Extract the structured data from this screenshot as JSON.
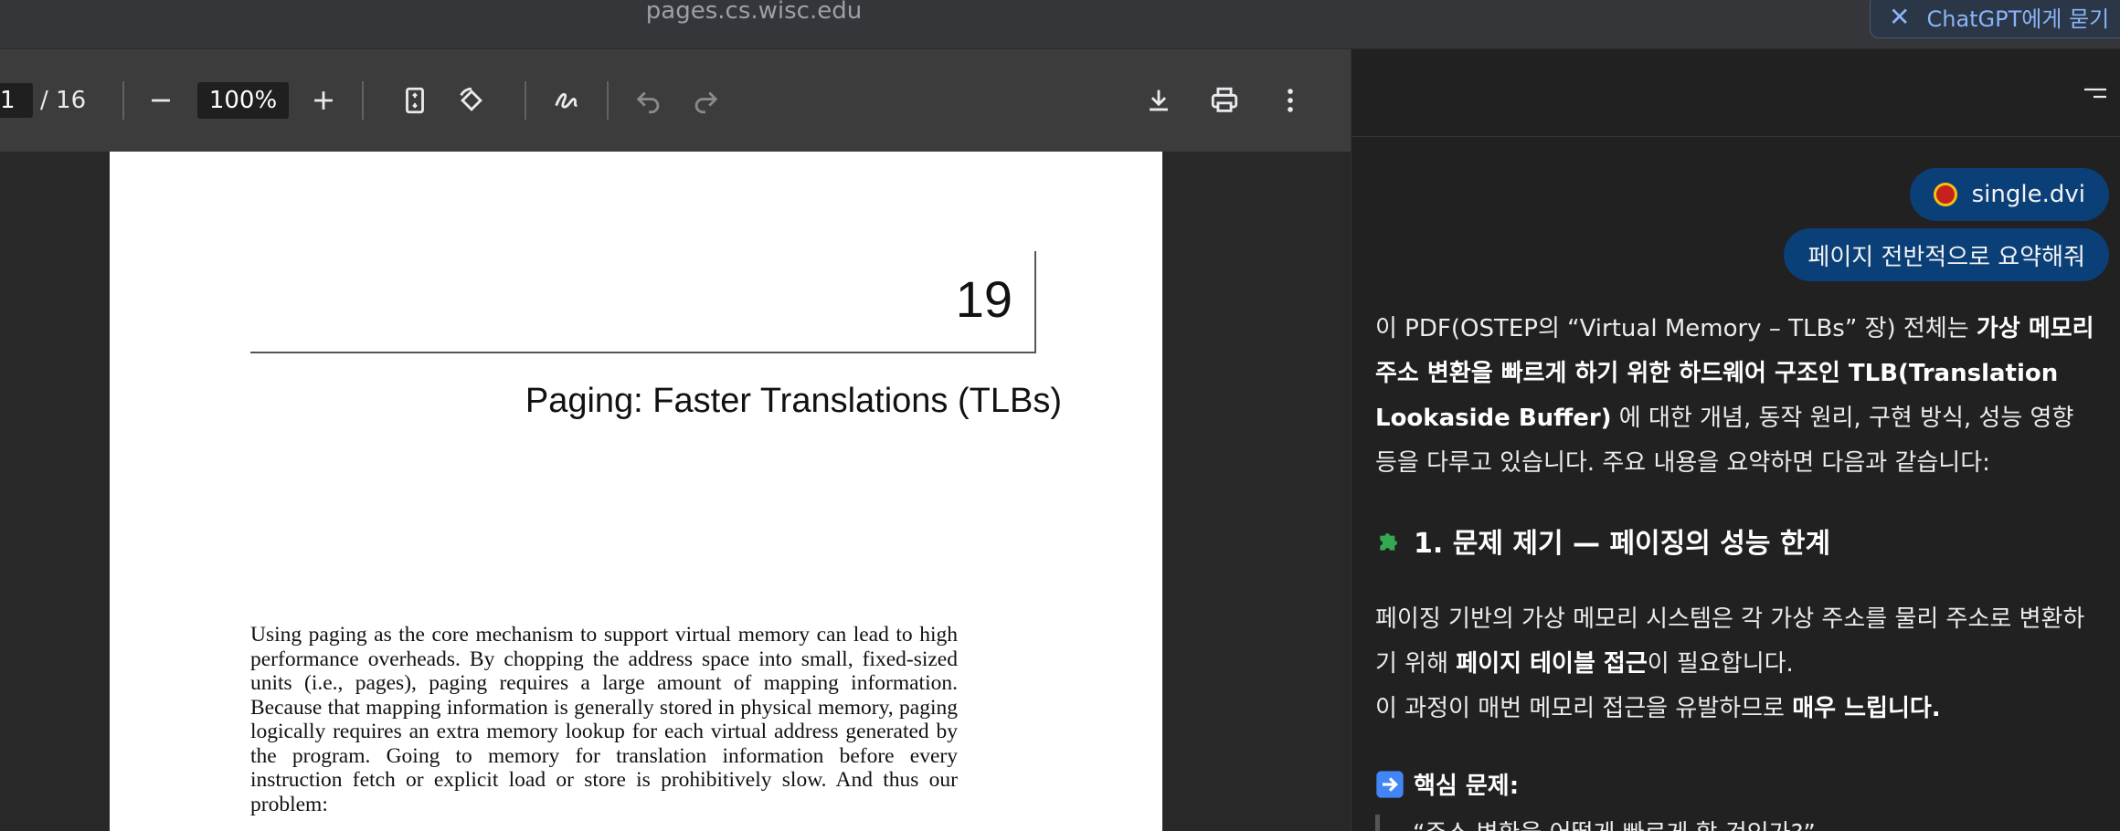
{
  "browser": {
    "url": "pages.cs.wisc.edu",
    "chatgpt_button": "ChatGPT에게 묻기"
  },
  "pdf_toolbar": {
    "current_page": "1",
    "total_pages": "/ 16",
    "zoom": "100%"
  },
  "pdf": {
    "chapter_number": "19",
    "chapter_title": "Paging: Faster Translations (TLBs)",
    "paragraph": "Using paging as the core mechanism to support virtual memory can lead to high performance overheads. By chopping the address space into small, fixed-sized units (i.e., pages), paging requires a large amount of mapping information. Because that mapping information is generally stored in physical memory, paging logically requires an extra memory lookup for each virtual address generated by the program. Going to memory for translation information before every instruction fetch or explicit load or store is prohibitively slow. And thus our problem:"
  },
  "chat": {
    "file_chip": "single.dvi",
    "user_message": "페이지 전반적으로 요약해줘",
    "answer_part1": "이 PDF(OSTEP의 “Virtual Memory – TLBs” 장) 전체는 ",
    "answer_bold1": "가상 메모리 주소 변환을 빠르게 하기 위한 하드웨어 구조인 TLB(Translation Lookaside Buffer)",
    "answer_part2": " 에 대한 개념, 동작 원리, 구현 방식, 성능 영향 등을 다루고 있습니다. 주요 내용을 요약하면 다음과 같습니다:",
    "section1_title": "1. 문제 제기 — 페이징의 성능 한계",
    "section1_p1a": "페이징 기반의 가상 메모리 시스템은 각 가상 주소를 물리 주소로 변환하기 위해 ",
    "section1_p1b": "페이지 테이블 접근",
    "section1_p1c": "이 필요합니다.",
    "section1_p2a": "이 과정이 매번 메모리 접근을 유발하므로 ",
    "section1_p2b": "매우 느립니다.",
    "core_problem": "핵심 문제:",
    "quote": "“주소 변환을 어떻게 빠르게 할 것인가?”",
    "accent_color": "#0b3f78"
  }
}
